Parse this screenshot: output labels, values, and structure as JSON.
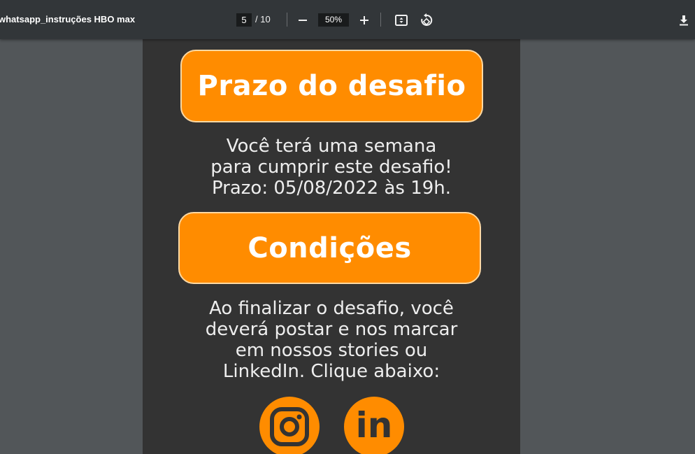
{
  "toolbar": {
    "title": "whatsapp_instruções HBO max",
    "page_current": "5",
    "page_total": "/ 10",
    "zoom_value": "50%",
    "icons": {
      "zoom_out": "minus-icon",
      "zoom_in": "plus-icon",
      "fit_page": "fit-to-page-icon",
      "rotate": "rotate-icon",
      "download": "download-icon"
    }
  },
  "page": {
    "deadline_heading": "Prazo do desafio",
    "deadline_lines": [
      "Você terá uma semana",
      "para cumprir este desafio!",
      "Prazo: 05/08/2022 às 19h."
    ],
    "conditions_heading": "Condições",
    "conditions_lines": [
      "Ao finalizar o desafio, você",
      "deverá postar e nos marcar",
      "em nossos stories ou",
      "LinkedIn. Clique abaixo:"
    ],
    "social": {
      "instagram_icon": "instagram-icon",
      "linkedin_icon": "linkedin-icon",
      "linkedin_glyph": "in"
    }
  },
  "colors": {
    "accent": "#ff8c00",
    "page_bg": "#333333",
    "viewer_bg": "#525659",
    "toolbar_bg": "#323639"
  }
}
